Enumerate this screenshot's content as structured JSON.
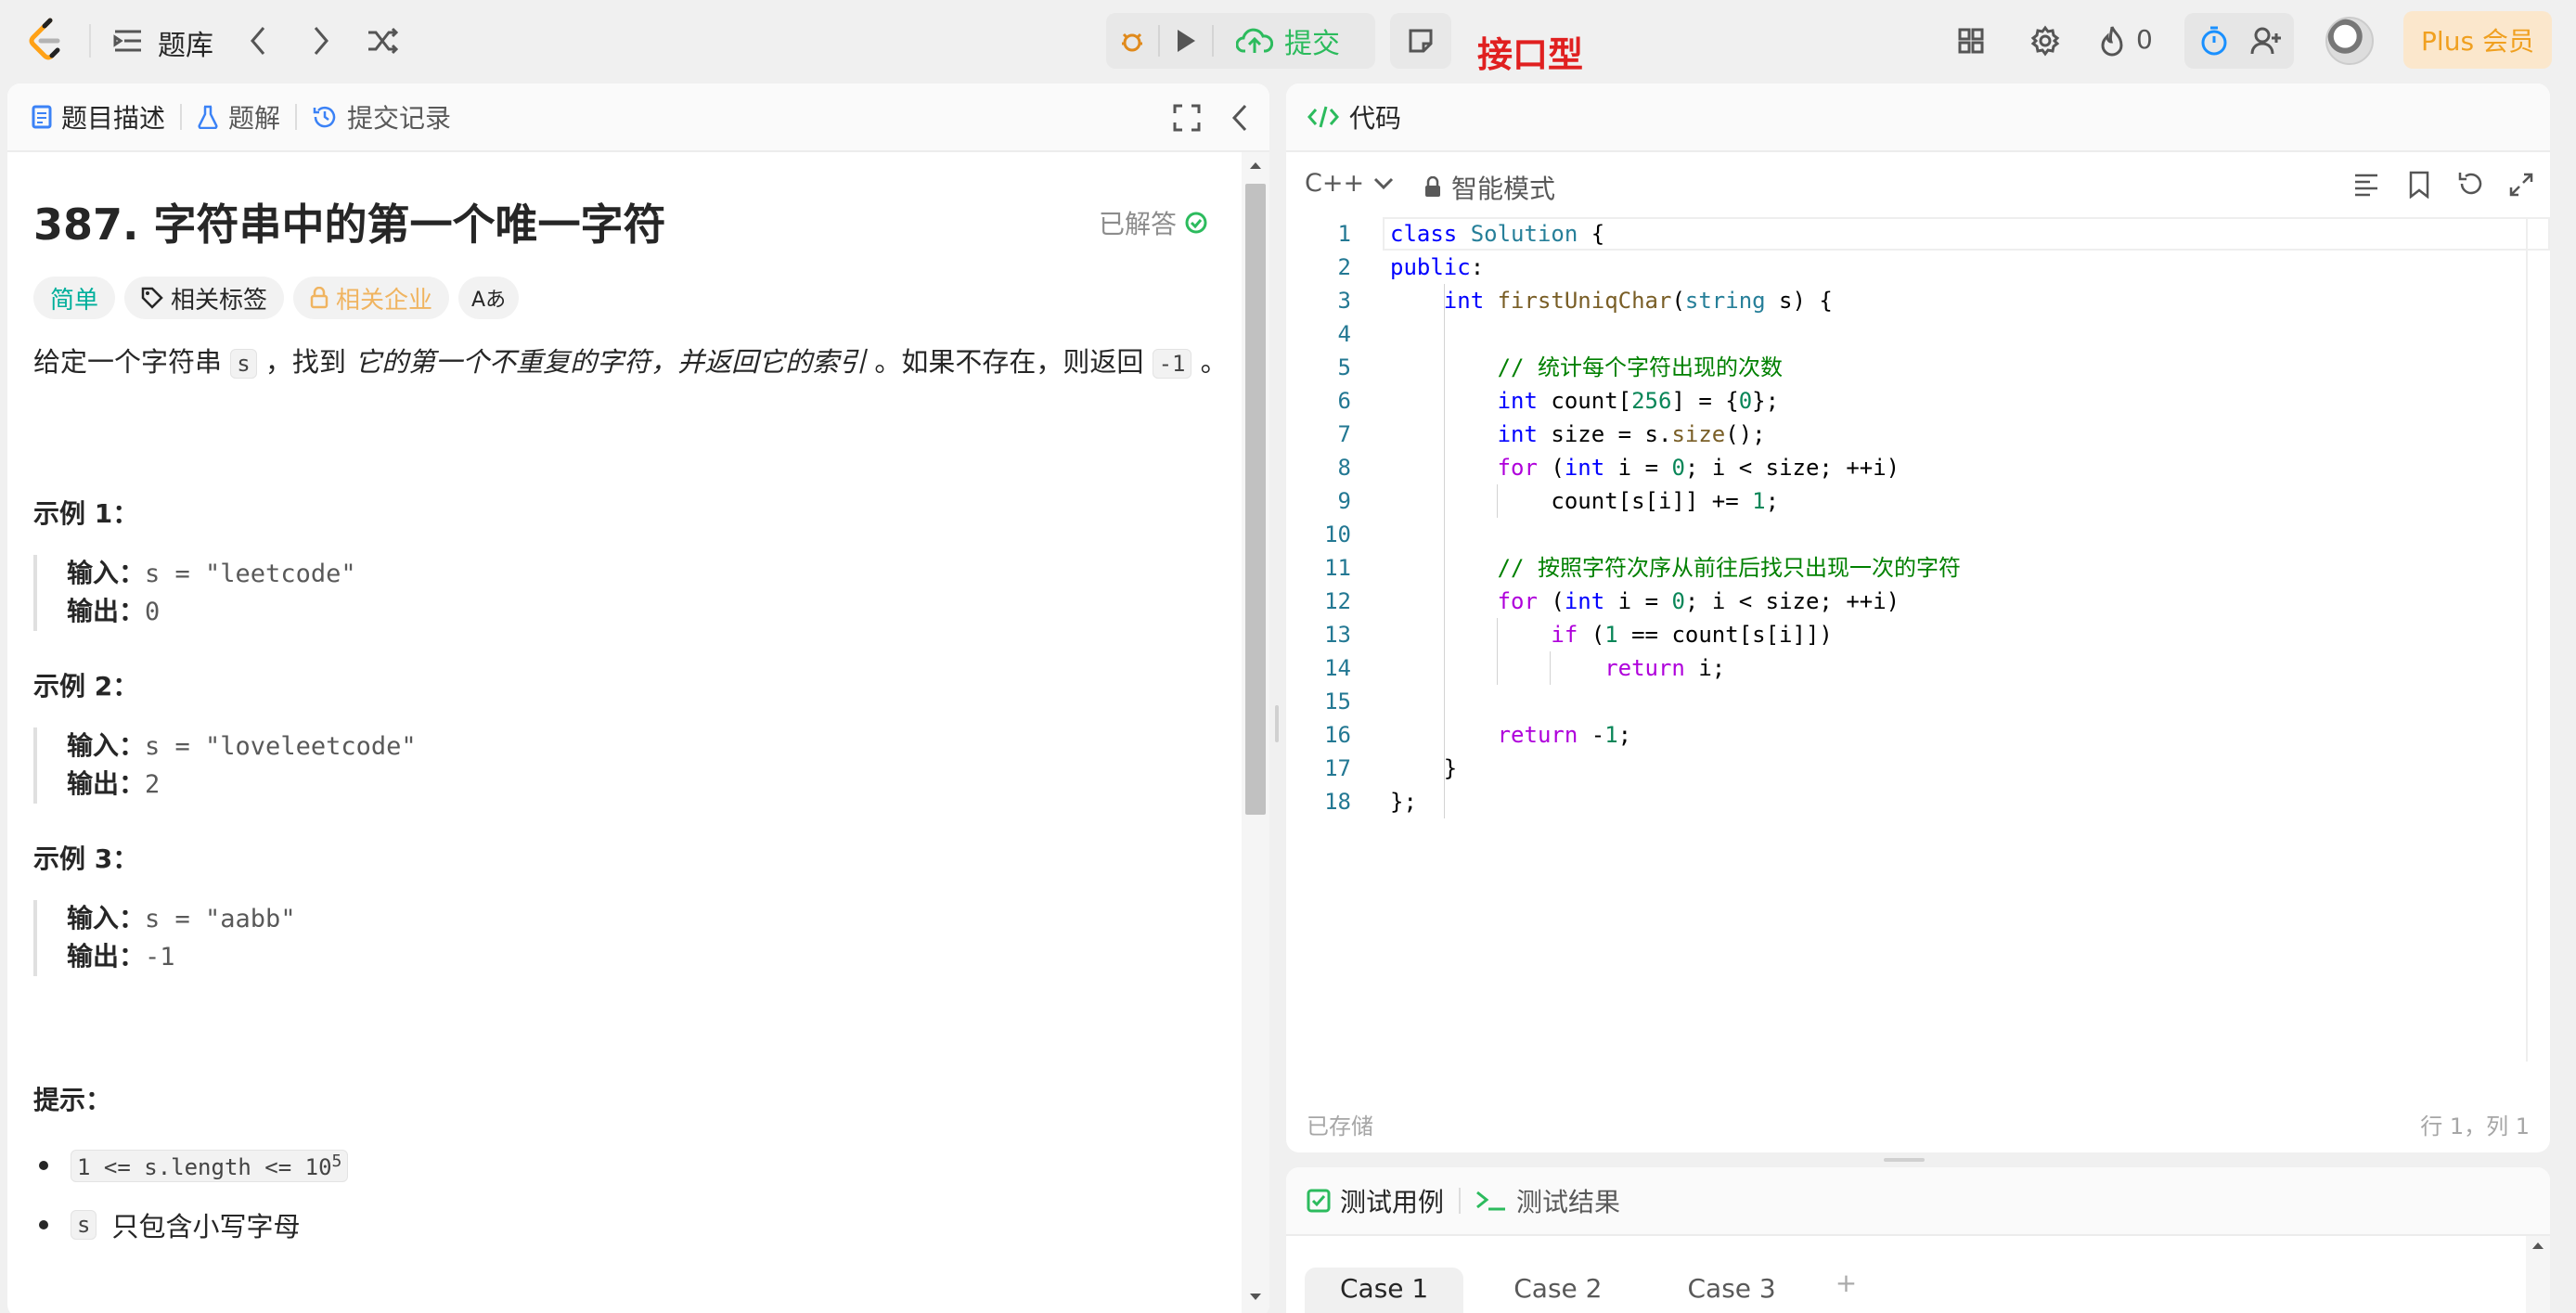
{
  "topbar": {
    "problem_bank_label": "题库",
    "submit_label": "提交",
    "interface_type_label": "接口型",
    "fire_count": "0",
    "plus_label": "Plus 会员",
    "icons": [
      "leetcode-logo",
      "list-icon",
      "chevron-left-icon",
      "chevron-right-icon",
      "shuffle-icon",
      "debug-icon",
      "play-icon",
      "cloud-upload-icon",
      "note-icon",
      "layout-icon",
      "gear-icon",
      "fire-icon",
      "timer-icon",
      "add-user-icon",
      "avatar"
    ]
  },
  "left_panel": {
    "tabs": [
      {
        "label": "题目描述",
        "icon": "document-icon",
        "color": "#3b82f6"
      },
      {
        "label": "题解",
        "icon": "flask-icon",
        "color": "#3b82f6"
      },
      {
        "label": "提交记录",
        "icon": "history-icon",
        "color": "#3b82f6"
      }
    ],
    "title": "387. 字符串中的第一个唯一字符",
    "solved_label": "已解答",
    "tags": {
      "difficulty": "简单",
      "topics": "相关标签",
      "companies": "相关企业",
      "translate": "Aあ"
    },
    "description": {
      "p1": "给定一个字符串 ",
      "code1": "s",
      "p2": " ，找到 ",
      "em": "它的第一个不重复的字符，并返回它的索引",
      "p3": " 。如果不存在，则返回 ",
      "code2": "-1",
      "p4": " 。"
    },
    "examples": [
      {
        "title": "示例 1：",
        "input_label": "输入：",
        "input": "s = \"leetcode\"",
        "output_label": "输出：",
        "output": "0"
      },
      {
        "title": "示例 2：",
        "input_label": "输入：",
        "input": "s = \"loveleetcode\"",
        "output_label": "输出：",
        "output": "2"
      },
      {
        "title": "示例 3：",
        "input_label": "输入：",
        "input": "s = \"aabb\"",
        "output_label": "输出：",
        "output": "-1"
      }
    ],
    "hints_title": "提示：",
    "hints": [
      {
        "code": "1 <= s.length <= 10",
        "sup": "5",
        "text": ""
      },
      {
        "code": "s",
        "sup": "",
        "text": "只包含小写字母"
      }
    ]
  },
  "code_panel": {
    "title": "代码",
    "language": "C++",
    "mode_label": "智能模式",
    "status_saved": "已存储",
    "cursor_position": "行 1，列 1",
    "lines": [
      "class Solution {",
      "public:",
      "    int firstUniqChar(string s) {",
      "",
      "        // 统计每个字符出现的次数",
      "        int count[256] = {0};",
      "        int size = s.size();",
      "        for (int i = 0; i < size; ++i)",
      "            count[s[i]] += 1;",
      "",
      "        // 按照字符次序从前往后找只出现一次的字符",
      "        for (int i = 0; i < size; ++i)",
      "            if (1 == count[s[i]])",
      "                return i;",
      "",
      "        return -1;",
      "    }",
      "};"
    ]
  },
  "test_panel": {
    "tabs": [
      {
        "label": "测试用例",
        "icon": "checkbox-icon"
      },
      {
        "label": "测试结果",
        "icon": "terminal-icon"
      }
    ],
    "cases": [
      "Case 1",
      "Case 2",
      "Case 3"
    ],
    "add_case": "+"
  },
  "colors": {
    "accent_green": "#2cbb5d",
    "easy_teal": "#00af9b",
    "company_gold": "#f0b460",
    "plus_orange": "#f0a020",
    "interface_red": "#e02020"
  }
}
